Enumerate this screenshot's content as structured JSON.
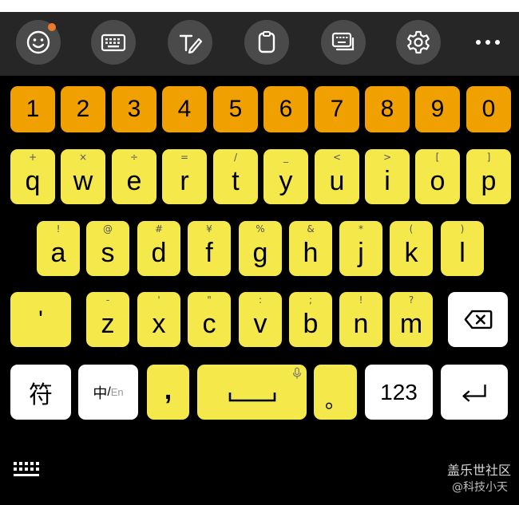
{
  "toolbar": {
    "buttons": [
      {
        "name": "emoji-icon",
        "notification": true
      },
      {
        "name": "keyboard-icon"
      },
      {
        "name": "handwriting-icon"
      },
      {
        "name": "clipboard-icon"
      },
      {
        "name": "keyboard-switch-icon"
      },
      {
        "name": "gear-icon"
      },
      {
        "name": "more-icon"
      }
    ]
  },
  "colors": {
    "number_key": "#f0a000",
    "letter_key": "#f4e84a",
    "function_key": "#ffffff",
    "toolbar_bg": "#262626",
    "notification_dot": "#f07a2a"
  },
  "numbers": [
    "1",
    "2",
    "3",
    "4",
    "5",
    "6",
    "7",
    "8",
    "9",
    "0"
  ],
  "row1": [
    {
      "main": "q",
      "sec": "+"
    },
    {
      "main": "w",
      "sec": "×"
    },
    {
      "main": "e",
      "sec": "÷"
    },
    {
      "main": "r",
      "sec": "="
    },
    {
      "main": "t",
      "sec": "/"
    },
    {
      "main": "y",
      "sec": "_"
    },
    {
      "main": "u",
      "sec": "<"
    },
    {
      "main": "i",
      "sec": ">"
    },
    {
      "main": "o",
      "sec": "["
    },
    {
      "main": "p",
      "sec": "]"
    }
  ],
  "row2": [
    {
      "main": "a",
      "sec": "!"
    },
    {
      "main": "s",
      "sec": "@"
    },
    {
      "main": "d",
      "sec": "#"
    },
    {
      "main": "f",
      "sec": "¥"
    },
    {
      "main": "g",
      "sec": "%"
    },
    {
      "main": "h",
      "sec": "&"
    },
    {
      "main": "j",
      "sec": "*"
    },
    {
      "main": "k",
      "sec": "("
    },
    {
      "main": "l",
      "sec": ")"
    }
  ],
  "row3": {
    "apostrophe": "'",
    "letters": [
      {
        "main": "z",
        "sec": "-"
      },
      {
        "main": "x",
        "sec": "'"
      },
      {
        "main": "c",
        "sec": "\""
      },
      {
        "main": "v",
        "sec": ":"
      },
      {
        "main": "b",
        "sec": ";"
      },
      {
        "main": "n",
        "sec": "!"
      },
      {
        "main": "m",
        "sec": "?"
      }
    ]
  },
  "row4": {
    "symbol_label": "符",
    "lang_main": "中",
    "lang_sep": "/",
    "lang_alt": "En",
    "comma": ",",
    "period": "。",
    "num_label": "123"
  },
  "watermark": {
    "line1": "盖乐世社区",
    "line2": "@科技小天"
  }
}
